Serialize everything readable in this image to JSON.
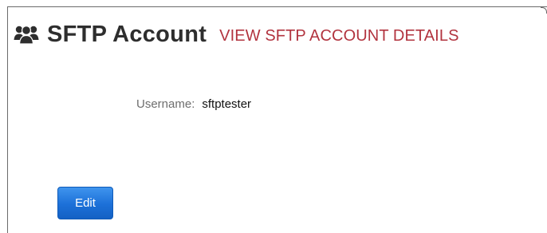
{
  "header": {
    "icon": "users-icon",
    "title": "SFTP Account",
    "subtitle": "VIEW SFTP ACCOUNT DETAILS"
  },
  "account": {
    "username_label": "Username:",
    "username_value": "sftptester"
  },
  "actions": {
    "edit_label": "Edit"
  },
  "colors": {
    "title": "#2e2e2e",
    "subtitle": "#b2343f",
    "button": "#1c70d8"
  }
}
